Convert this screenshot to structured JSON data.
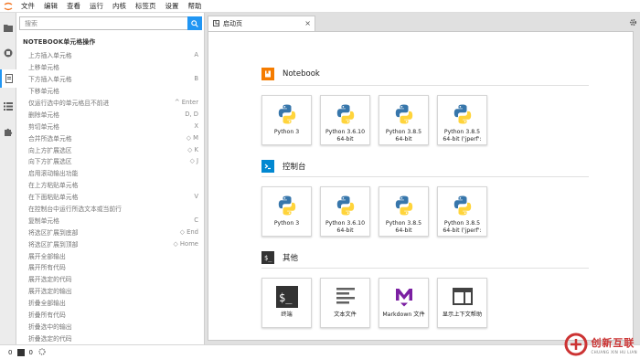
{
  "menu": [
    "文件",
    "编辑",
    "查看",
    "运行",
    "内核",
    "标签页",
    "设置",
    "帮助"
  ],
  "sidebar_icons": [
    "folder-icon",
    "running-icon",
    "commands-icon",
    "tabs-icon",
    "extension-icon"
  ],
  "commands": {
    "search_placeholder": "搜索",
    "section_title": "NOTEBOOK单元格操作",
    "items": [
      {
        "label": "上方插入单元格",
        "key": "A"
      },
      {
        "label": "上移单元格",
        "key": ""
      },
      {
        "label": "下方插入单元格",
        "key": "B"
      },
      {
        "label": "下移单元格",
        "key": ""
      },
      {
        "label": "仅运行选中的单元格且不前进",
        "key": "^ Enter"
      },
      {
        "label": "删除单元格",
        "key": "D, D"
      },
      {
        "label": "剪切单元格",
        "key": "X"
      },
      {
        "label": "合并所选单元格",
        "key": "◇ M"
      },
      {
        "label": "向上方扩展选区",
        "key": "◇ K"
      },
      {
        "label": "向下方扩展选区",
        "key": "◇ J"
      },
      {
        "label": "启用滚动输出功能",
        "key": ""
      },
      {
        "label": "在上方粘贴单元格",
        "key": ""
      },
      {
        "label": "在下面粘贴单元格",
        "key": "V"
      },
      {
        "label": "在控制台中运行所选文本或当前行",
        "key": ""
      },
      {
        "label": "复制单元格",
        "key": "C"
      },
      {
        "label": "将选区扩展到底部",
        "key": "◇ End"
      },
      {
        "label": "将选区扩展到顶部",
        "key": "◇ Home"
      },
      {
        "label": "展开全部输出",
        "key": ""
      },
      {
        "label": "展开所有代码",
        "key": ""
      },
      {
        "label": "展开选定的代码",
        "key": ""
      },
      {
        "label": "展开选定的输出",
        "key": ""
      },
      {
        "label": "折叠全部输出",
        "key": ""
      },
      {
        "label": "折叠所有代码",
        "key": ""
      },
      {
        "label": "折叠选中的输出",
        "key": ""
      },
      {
        "label": "折叠选定的代码",
        "key": ""
      }
    ]
  },
  "tab": {
    "label": "启动页",
    "close": "×"
  },
  "launcher": {
    "sections": [
      {
        "title": "Notebook",
        "icon": "notebook-icon",
        "cards": [
          {
            "label": "Python 3",
            "icon": "python-logo-icon"
          },
          {
            "label": "Python 3.6.10\n64-bit",
            "icon": "python-logo-icon"
          },
          {
            "label": "Python 3.8.5\n64-bit",
            "icon": "python-logo-icon"
          },
          {
            "label": "Python 3.8.5\n64-bit ('jperf':",
            "icon": "python-logo-icon"
          }
        ]
      },
      {
        "title": "控制台",
        "icon": "console-icon",
        "cards": [
          {
            "label": "Python 3",
            "icon": "python-logo-icon"
          },
          {
            "label": "Python 3.6.10\n64-bit",
            "icon": "python-logo-icon"
          },
          {
            "label": "Python 3.8.5\n64-bit",
            "icon": "python-logo-icon"
          },
          {
            "label": "Python 3.8.5\n64-bit ('jperf':",
            "icon": "python-logo-icon"
          }
        ]
      },
      {
        "title": "其他",
        "icon": "other-icon",
        "cards": [
          {
            "label": "终端",
            "icon": "terminal-icon"
          },
          {
            "label": "文本文件",
            "icon": "text-file-icon"
          },
          {
            "label": "Markdown 文件",
            "icon": "markdown-icon"
          },
          {
            "label": "显示上下文帮助",
            "icon": "context-help-icon"
          }
        ]
      }
    ]
  },
  "status": {
    "kernels": "0",
    "terminals": "0"
  },
  "watermark": {
    "cn": "创新互联",
    "en": "CHUANG XIN HU LIAN"
  },
  "colors": {
    "accent": "#2196f3",
    "notebook_orange": "#f57c00",
    "markdown_purple": "#7b1fa2",
    "python_blue": "#3776ab",
    "python_yellow": "#ffd43b"
  }
}
